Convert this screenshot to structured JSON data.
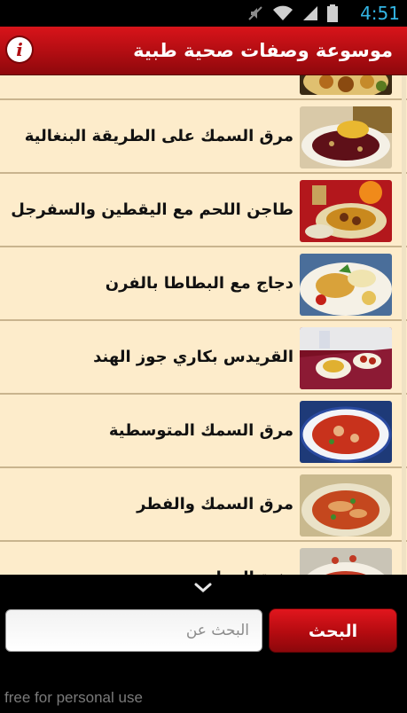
{
  "status_bar": {
    "time": "4:51",
    "icons": [
      "mute-icon",
      "wifi-icon",
      "signal-icon",
      "battery-icon"
    ],
    "accent_color": "#33b5e5"
  },
  "header": {
    "title": "موسوعة وصفات صحية طبية",
    "info_icon": "i",
    "bg_color": "#b10d12"
  },
  "list": {
    "items": [
      {
        "label": "",
        "thumb": "food-photo-platter"
      },
      {
        "label": "مرق السمك على الطريقة البنغالية",
        "thumb": "food-photo-fish-broth-bengali"
      },
      {
        "label": "طاجن اللحم مع اليقطين والسفرجل",
        "thumb": "food-photo-meat-tajine"
      },
      {
        "label": "دجاج مع البطاطا بالفرن",
        "thumb": "food-photo-baked-chicken"
      },
      {
        "label": "القريدس بكاري جوز الهند",
        "thumb": "food-photo-shrimp-curry"
      },
      {
        "label": "مرق السمك المتوسطية",
        "thumb": "food-photo-mediterranean-fish-broth"
      },
      {
        "label": "مرق السمك والفطر",
        "thumb": "food-photo-fish-mushroom-broth"
      },
      {
        "label": "يخنة الدجاج",
        "thumb": "food-photo-chicken-stew"
      }
    ],
    "bg_color": "#fdeccb"
  },
  "search": {
    "placeholder": "البحث عن",
    "button_label": "البحث",
    "collapse_icon": "chevron-down-icon"
  },
  "watermark": "free for personal use"
}
